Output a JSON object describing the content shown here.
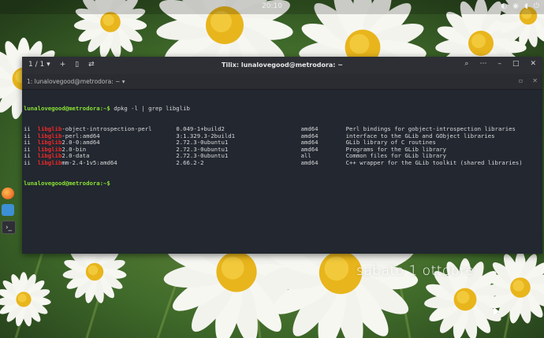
{
  "topbar": {
    "clock": "20:10"
  },
  "terminal": {
    "window_title": "Tilix: lunalovegood@metrodora: ~",
    "session_counter": "1 / 1",
    "tab_label": "1: lunalovegood@metrodora: ~",
    "prompt": "lunalovegood@metrodora:~$",
    "command": " dpkg -l | grep libglib",
    "rows": [
      {
        "status": "ii",
        "pre": "",
        "match": "libglib",
        "post": "-object-introspection-perl",
        "version": "0.049-1+build2",
        "arch": "amd64",
        "desc": "Perl bindings for gobject-introspection libraries"
      },
      {
        "status": "ii",
        "pre": "",
        "match": "libglib",
        "post": "-perl:amd64",
        "version": "3:1.329.3-2build1",
        "arch": "amd64",
        "desc": "interface to the GLib and GObject libraries"
      },
      {
        "status": "ii",
        "pre": "",
        "match": "libglib",
        "post": "2.0-0:amd64",
        "version": "2.72.3-0ubuntu1",
        "arch": "amd64",
        "desc": "GLib library of C routines"
      },
      {
        "status": "ii",
        "pre": "",
        "match": "libglib",
        "post": "2.0-bin",
        "version": "2.72.3-0ubuntu1",
        "arch": "amd64",
        "desc": "Programs for the GLib library"
      },
      {
        "status": "ii",
        "pre": "",
        "match": "libglib",
        "post": "2.0-data",
        "version": "2.72.3-0ubuntu1",
        "arch": "all",
        "desc": "Common files for GLib library"
      },
      {
        "status": "ii",
        "pre": "",
        "match": "libglib",
        "post": "mm-2.4-1v5:amd64",
        "version": "2.66.2-2",
        "arch": "amd64",
        "desc": "C++ wrapper for the GLib toolkit (shared libraries)"
      }
    ],
    "final_prompt": "lunalovegood@metrodora:~$"
  },
  "desktop": {
    "date_text": "sabato  1 ottobre"
  },
  "icons": {
    "dock": [
      "firefox-icon",
      "files-icon",
      "terminal-icon"
    ],
    "titlebar_left": [
      "new-session-icon",
      "add-terminal-icon",
      "split-icon",
      "sync-input-icon"
    ],
    "titlebar_right": [
      "search-icon",
      "menu-icon",
      "minimize-icon",
      "maximize-icon",
      "close-icon"
    ]
  },
  "colors": {
    "prompt": "#8ae234",
    "match": "#ef2929",
    "terminal_bg": "#222730"
  }
}
